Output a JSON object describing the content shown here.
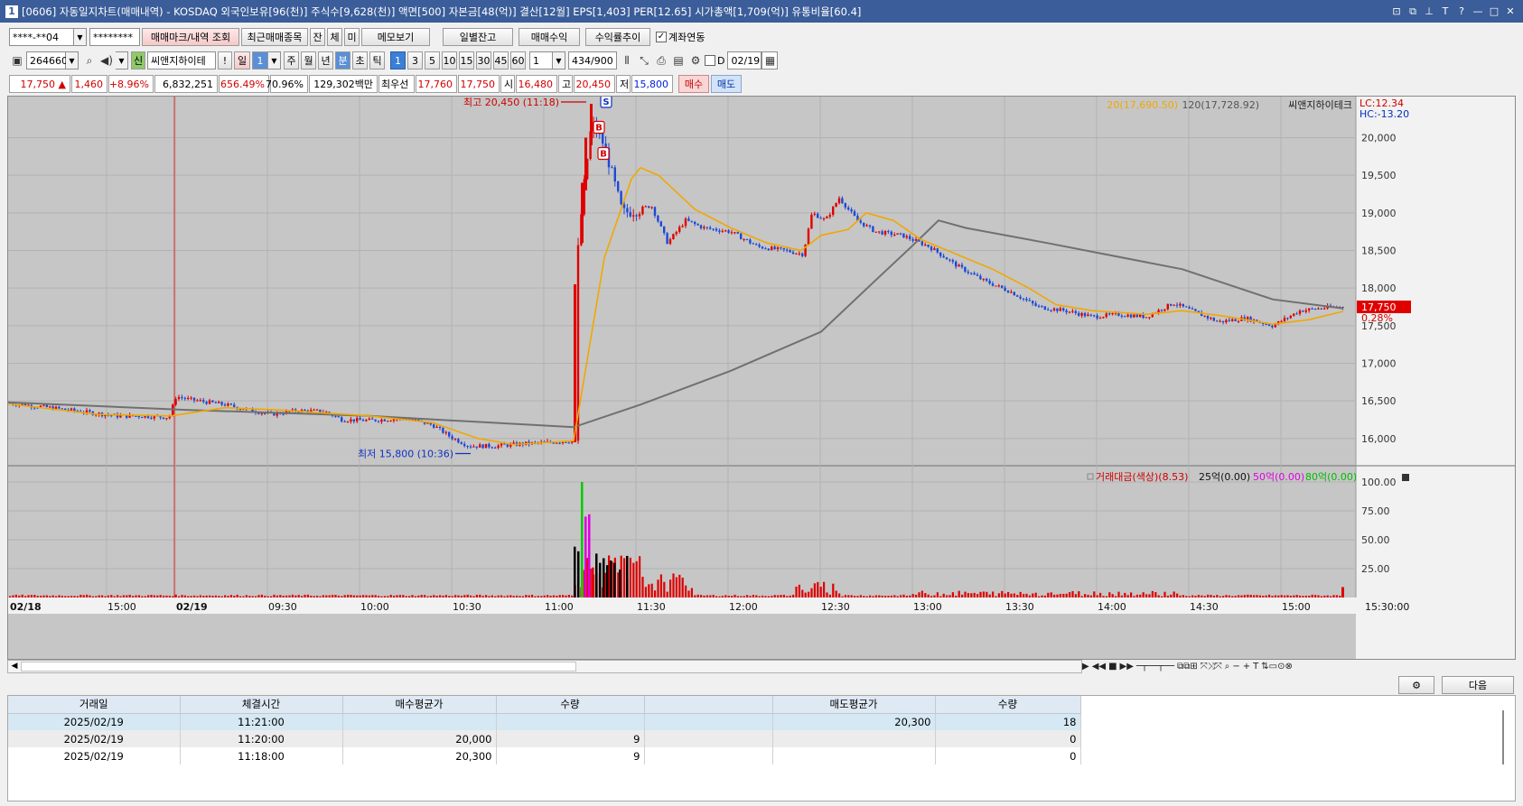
{
  "title": {
    "num": "1",
    "text": "[0606] 자동일지차트(매매내역) - KOSDAQ 외국인보유[96(천)] 주식수[9,628(천)] 액면[500] 자본금[48(억)] 결산[12월] EPS[1,403] PER[12.65] 시가총액[1,709(억)] 유통비율[60.4]"
  },
  "toolbar1": {
    "account": "****-**04",
    "password": "********",
    "btn_mark": "매매마크/내역 조회",
    "btn_recent": "최근매매종목",
    "btn_jan": "잔",
    "btn_che": "체",
    "btn_mi": "미",
    "btn_memo": "메모보기",
    "btn_daily": "일별잔고",
    "btn_profit": "매매수익",
    "btn_trend": "수익률추이",
    "chk_link": "계좌연동"
  },
  "toolbar2": {
    "code": "264660",
    "badge_new": "신",
    "stock_name": "씨앤지하이테",
    "excl": "!",
    "period_day": "일",
    "period_num": "1",
    "p_week": "주",
    "p_month": "월",
    "p_year": "년",
    "p_min": "분",
    "p_sec": "초",
    "p_tick": "틱",
    "intervals": [
      "1",
      "3",
      "5",
      "10",
      "15",
      "30",
      "45",
      "60"
    ],
    "count": "1",
    "range": "434",
    "range_max": "/900",
    "date_label": "D",
    "date_value": "02/19"
  },
  "quote": {
    "price": "17,750",
    "arrow": "▲",
    "change": "1,460",
    "pct": "+8.96%",
    "volume": "6,832,251",
    "vol_pct": "656.49%",
    "ratio": "70.96%",
    "amount": "129,302백만",
    "best_label": "최우선",
    "best_ask": "17,760",
    "best_bid": "17,750",
    "open_label": "시",
    "open": "16,480",
    "high_label": "고",
    "high": "20,450",
    "low_label": "저",
    "low": "15,800",
    "buy_btn": "매수",
    "sell_btn": "매도"
  },
  "chart": {
    "legend_ma20": "20(17,690.50)",
    "legend_ma120": "120(17,728.92)",
    "legend_name": "씨앤지하이테크",
    "lc": "LC:12.34",
    "hc": "HC:-13.20",
    "price_ticks": [
      "20,000",
      "19,500",
      "19,000",
      "18,500",
      "18,000",
      "17,500",
      "17,000",
      "16,500",
      "16,000"
    ],
    "current_price": "17,750",
    "current_pct": "0.28%",
    "high_annot": "최고 20,450 (11:18)",
    "low_annot": "최저 15,800 (10:36)",
    "mark_s": "S",
    "mark_b": "B",
    "vol_legend_title": "거래대금(색상)(8.53)",
    "vol_legend_25": "25억(0.00)",
    "vol_legend_50": "50억(0.00)",
    "vol_legend_80": "80억(0.00)",
    "vol_ticks": [
      "100.00",
      "75.00",
      "50.00",
      "25.00"
    ],
    "time_labels": [
      "02/18",
      "15:00",
      "02/19",
      "09:30",
      "10:00",
      "10:30",
      "11:00",
      "11:30",
      "12:00",
      "12:30",
      "13:00",
      "13:30",
      "14:00",
      "14:30",
      "15:00",
      "15:30:00"
    ],
    "colors": {
      "up": "#e00000",
      "down": "#1e48d8",
      "ma20": "#f0a800",
      "ma120": "#707070"
    }
  },
  "chart_data": {
    "type": "candlestick",
    "y_range": [
      15650,
      20450
    ],
    "ma_series": [
      "20",
      "120"
    ],
    "annotations": [
      {
        "label": "최고 20,450 (11:18)",
        "value": 20450
      },
      {
        "label": "최저 15,800 (10:36)",
        "value": 15800
      }
    ],
    "current": 17750
  },
  "bottom": {
    "next_btn": "다음"
  },
  "table": {
    "headers": [
      "거래일",
      "체결시간",
      "매수평균가",
      "수량",
      "",
      "매도평균가",
      "수량"
    ],
    "rows": [
      [
        "2025/02/19",
        "11:21:00",
        "",
        "",
        "",
        "20,300",
        "18"
      ],
      [
        "2025/02/19",
        "11:20:00",
        "20,000",
        "9",
        "",
        "",
        "0"
      ],
      [
        "2025/02/19",
        "11:18:00",
        "20,300",
        "9",
        "",
        "",
        "0"
      ]
    ]
  }
}
